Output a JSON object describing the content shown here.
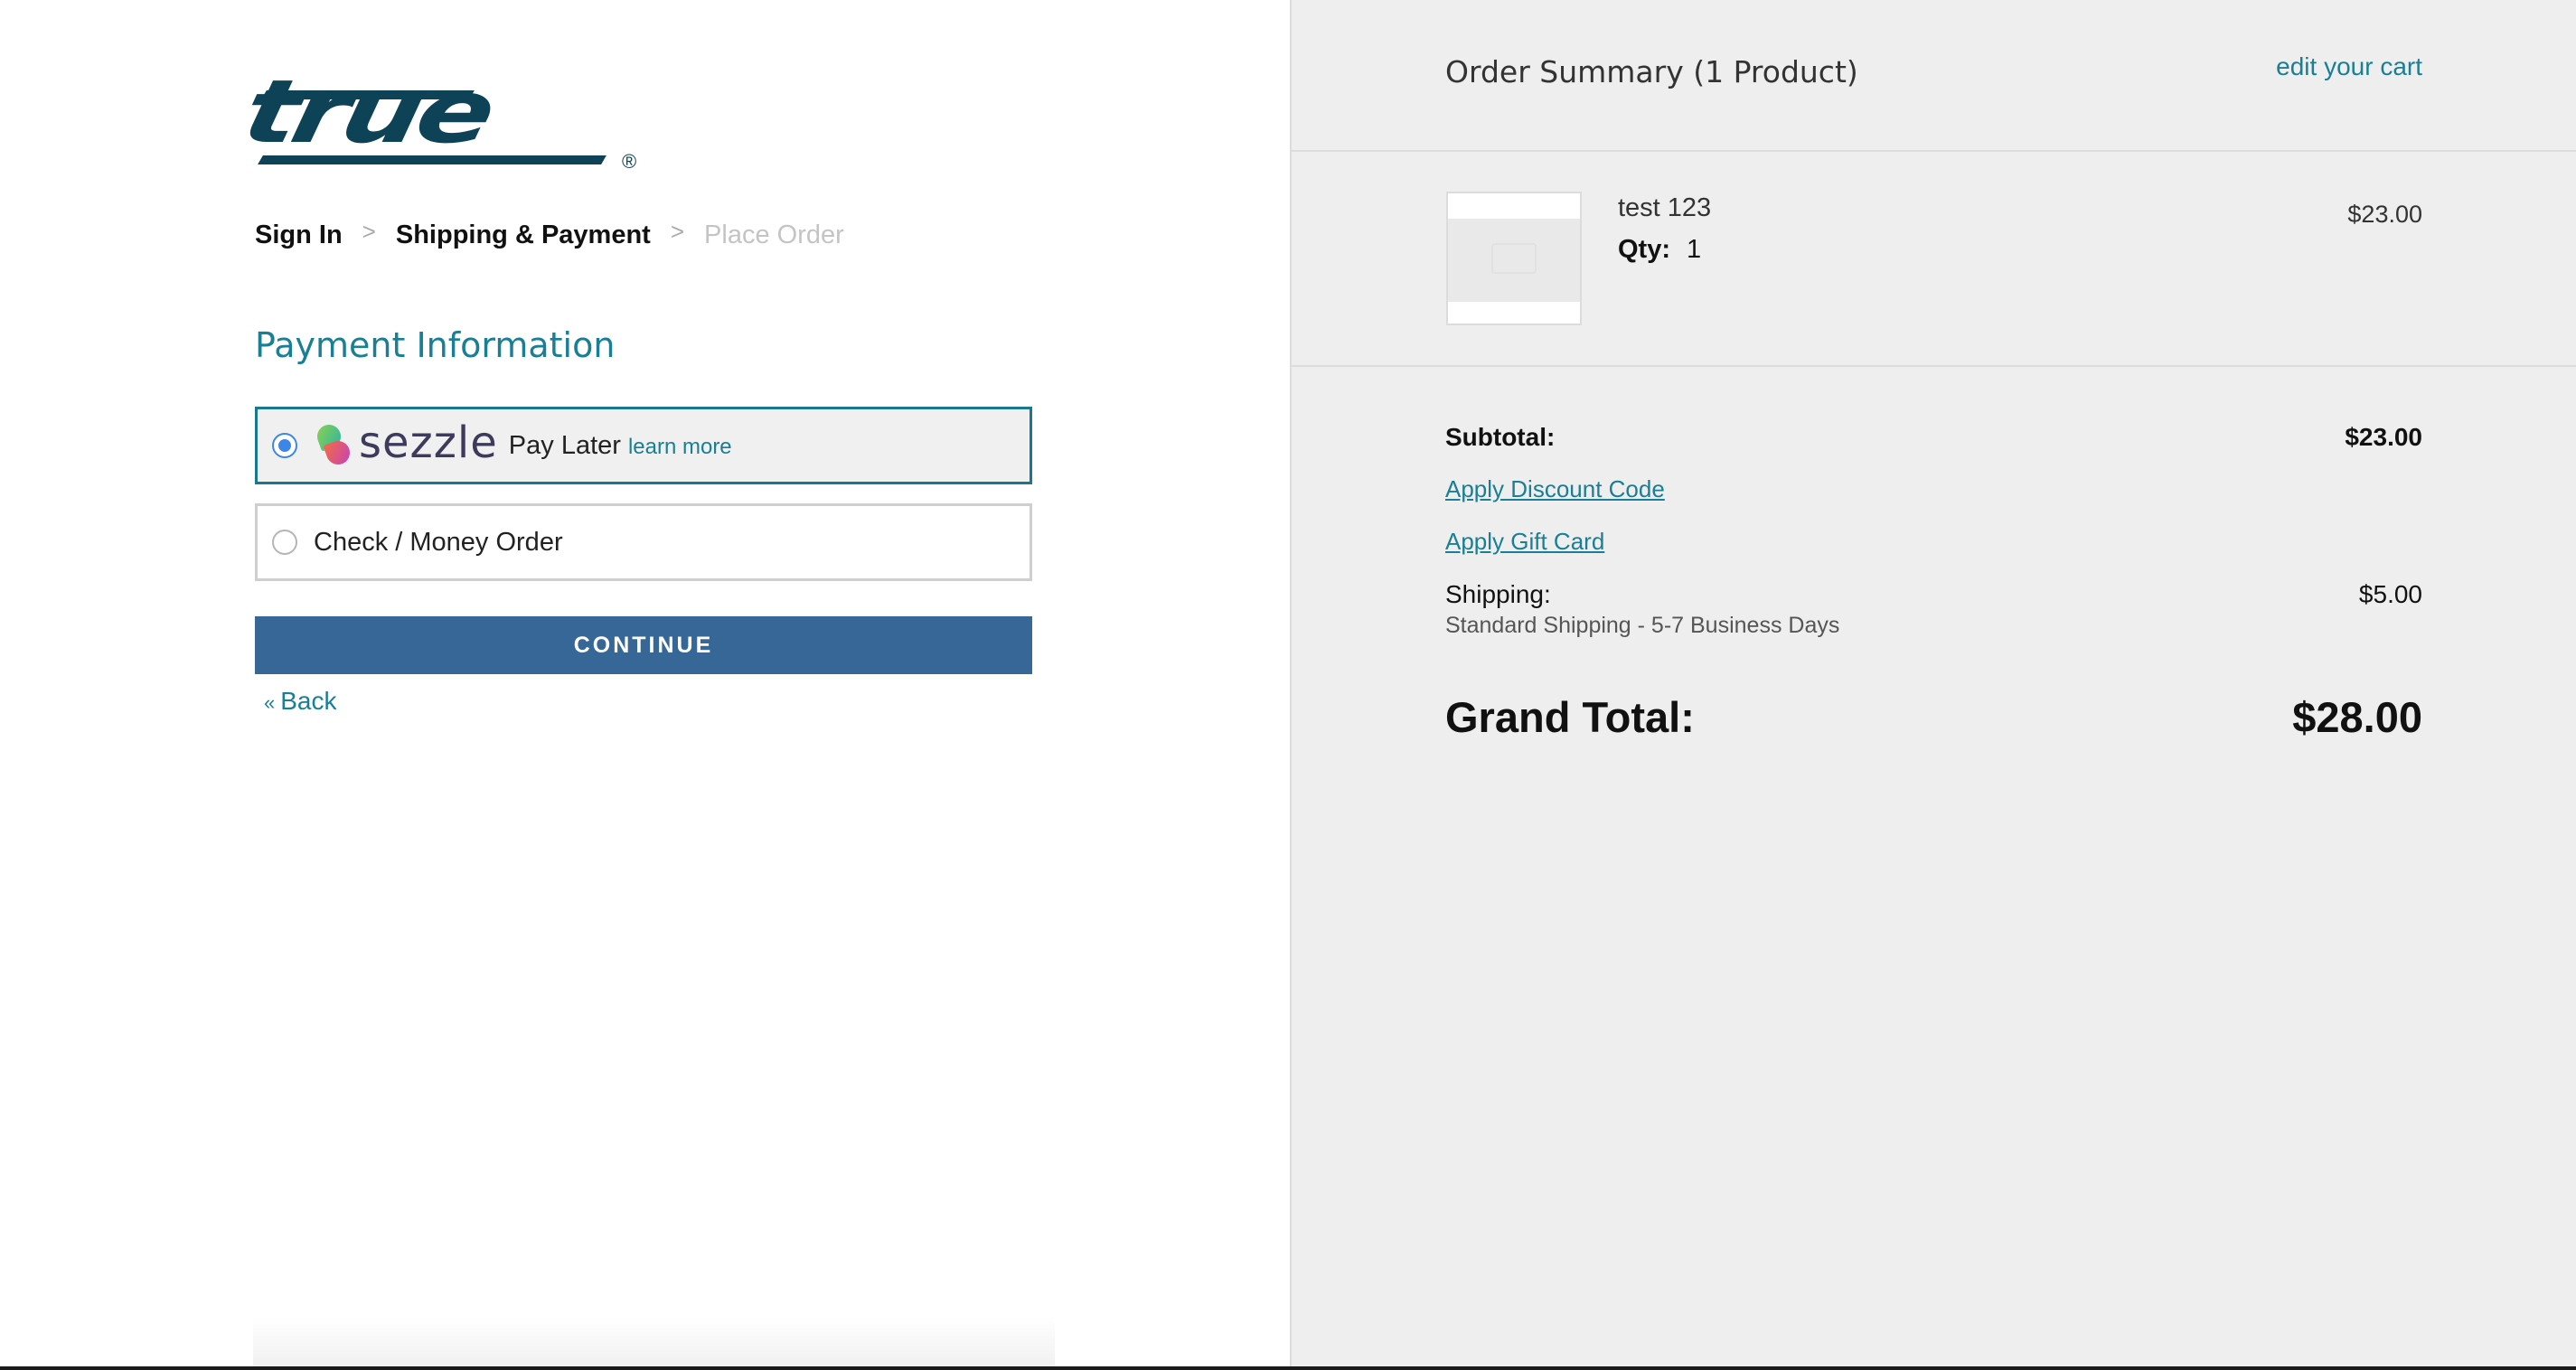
{
  "brand": {
    "logo_text": "true",
    "registered_mark": "®",
    "color": "#0d4257"
  },
  "breadcrumb": {
    "steps": [
      "Sign In",
      "Shipping & Payment",
      "Place Order"
    ],
    "separator": ">"
  },
  "payment": {
    "heading": "Payment Information",
    "options": [
      {
        "brand": "sezzle",
        "label": "Pay Later",
        "link": "learn more",
        "selected": true
      },
      {
        "label": "Check / Money Order",
        "selected": false
      }
    ],
    "continue_label": "CONTINUE",
    "back_symbol": "«",
    "back_label": "Back"
  },
  "summary": {
    "title": "Order Summary (1 Product)",
    "edit_link": "edit your cart",
    "item": {
      "name": "test 123",
      "qty_label": "Qty:",
      "qty": "1",
      "price": "$23.00"
    },
    "subtotal_label": "Subtotal:",
    "subtotal_value": "$23.00",
    "discount_link": "Apply Discount Code",
    "giftcard_link": "Apply Gift Card",
    "shipping_label": "Shipping:",
    "shipping_value": "$5.00",
    "shipping_method": "Standard Shipping - 5-7 Business Days",
    "grand_total_label": "Grand Total:",
    "grand_total_value": "$28.00"
  },
  "colors": {
    "accent_teal": "#1a7f94",
    "button_blue": "#376796",
    "radio_blue": "#3d86e6",
    "summary_bg": "#eeeeee"
  }
}
